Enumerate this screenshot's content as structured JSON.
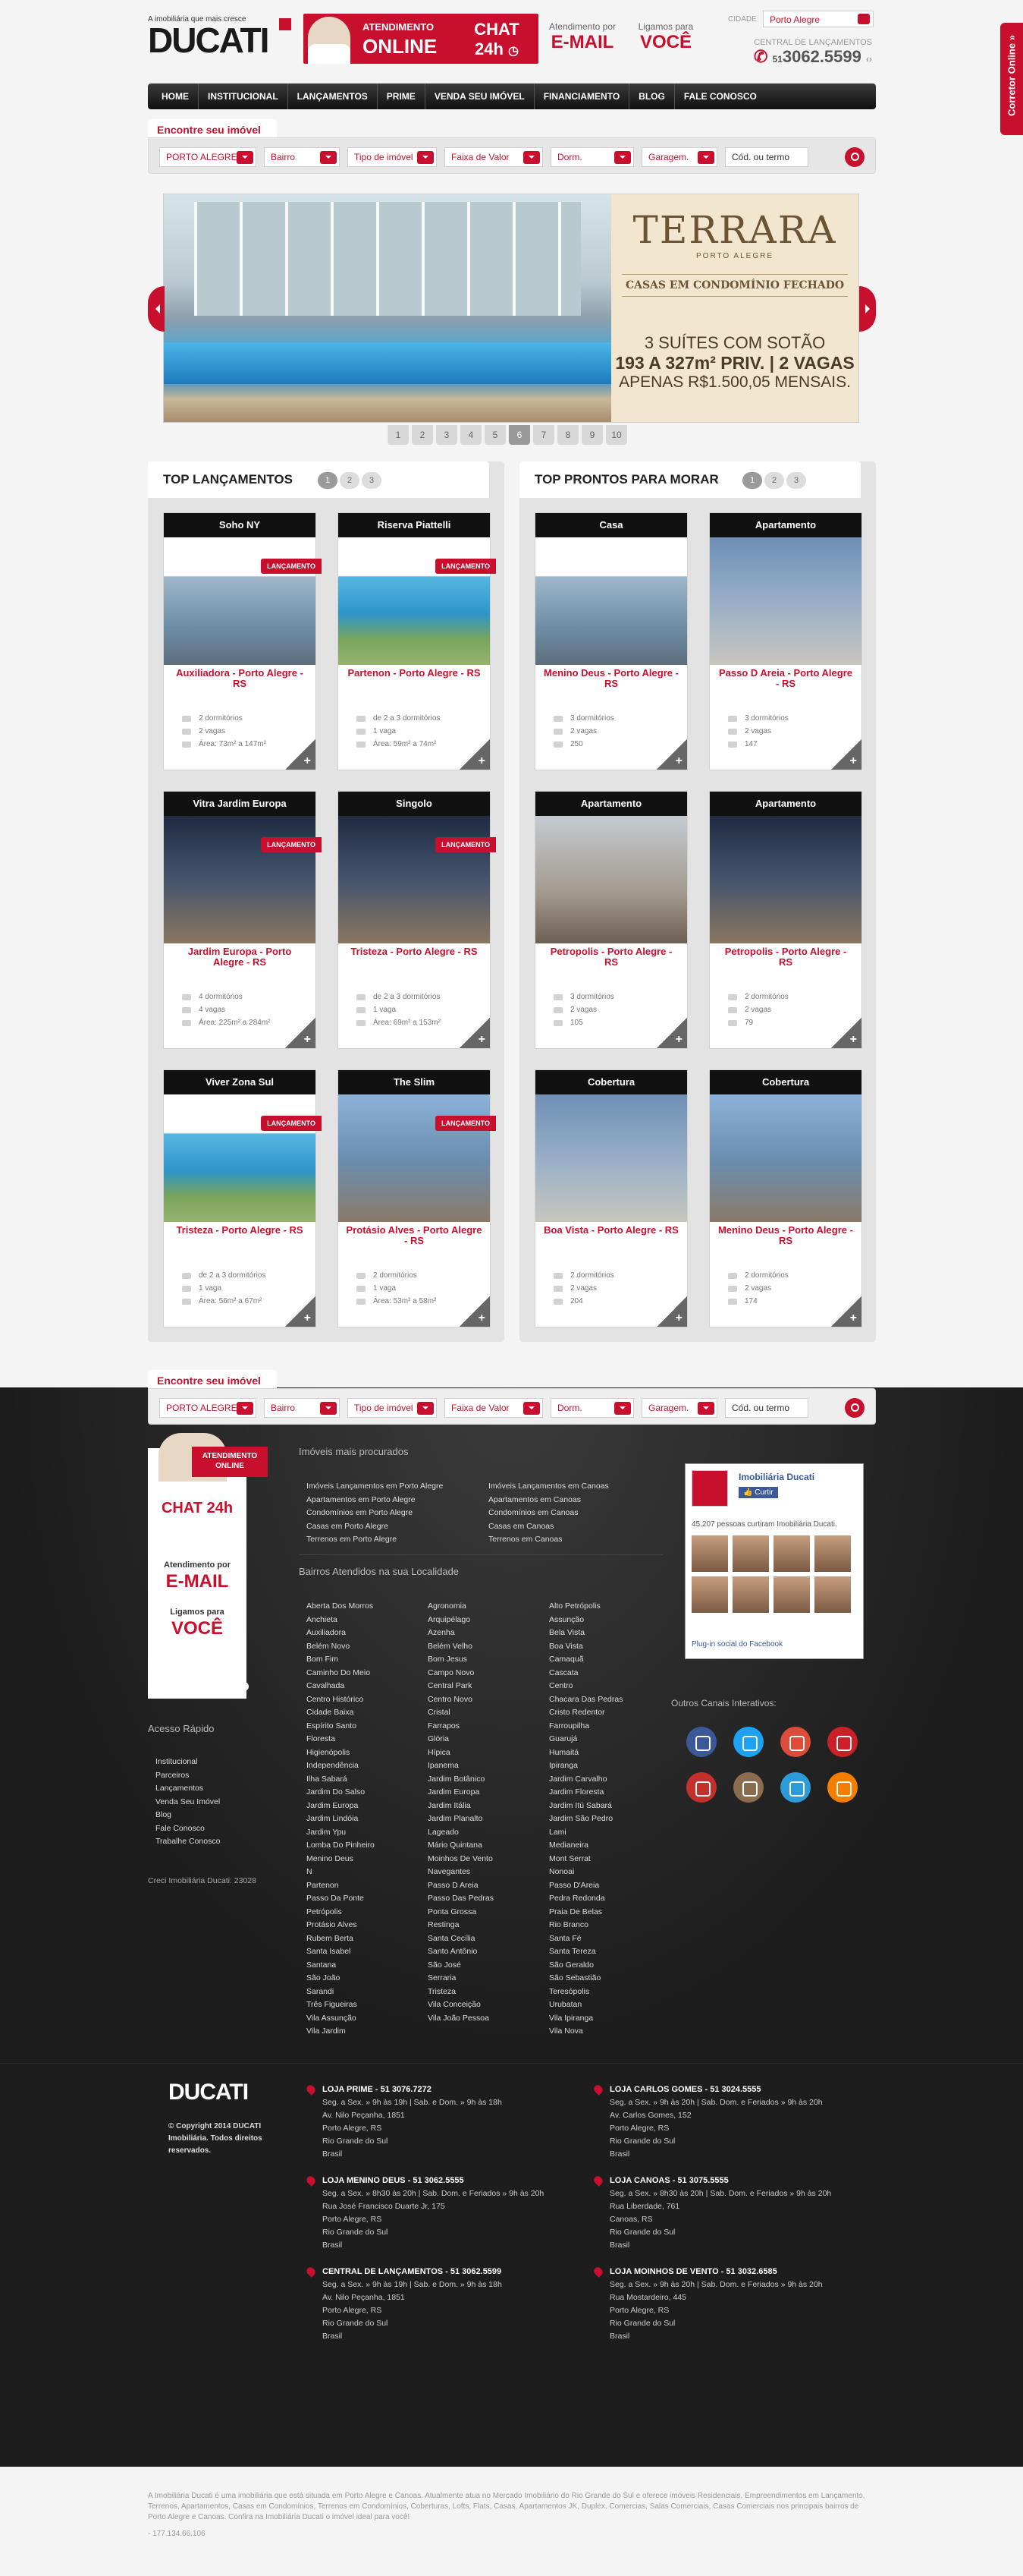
{
  "brand": {
    "tagline": "A imobiliária que mais cresce",
    "name": "DUCATI"
  },
  "banner": {
    "atendimento": "ATENDIMENTO",
    "online": "ONLINE",
    "chat": "CHAT",
    "hours": "24h"
  },
  "header_cols": [
    {
      "label": "Atendimento por",
      "value": "E-MAIL"
    },
    {
      "label": "Ligamos para",
      "value": "VOCÊ"
    }
  ],
  "city": {
    "label": "CIDADE",
    "value": "Porto Alegre"
  },
  "central": {
    "label": "CENTRAL DE LANÇAMENTOS",
    "ddd": "51",
    "phone": "3062.5599"
  },
  "nav": [
    "HOME",
    "INSTITUCIONAL",
    "LANÇAMENTOS",
    "PRIME",
    "VENDA SEU IMÓVEL",
    "FINANCIAMENTO",
    "BLOG",
    "FALE CONOSCO"
  ],
  "search": {
    "title": "Encontre seu imóvel",
    "fields": [
      "PORTO ALEGRE",
      "Bairro",
      "Tipo de imóvel",
      "Faixa de Valor",
      "Dorm.",
      "Garagem.",
      "Cód. ou termo"
    ]
  },
  "slide": {
    "brand": "TERRARA",
    "city": "PORTO ALEGRE",
    "subtitle": "CASAS EM CONDOMÍNIO FECHADO",
    "line1": "3 SUÍTES COM SOTÃO",
    "line2": "193 A 327m² PRIV. | 2 VAGAS",
    "line3": "APENAS R$1.500,05 MENSAIS."
  },
  "slide_pages": [
    "1",
    "2",
    "3",
    "4",
    "5",
    "6",
    "7",
    "8",
    "9",
    "10"
  ],
  "slide_active": "6",
  "lancamentos": {
    "title": "TOP LANÇAMENTOS",
    "pages": [
      "1",
      "2",
      "3"
    ],
    "badge": "LANÇAMENTO",
    "cards": [
      {
        "name": "Soho NY",
        "title": "Auxiliadora - Porto Alegre - RS",
        "d1": "2 dormitórios",
        "d2": "2 vagas",
        "d3": "Área: 73m² a 147m²"
      },
      {
        "name": "Riserva Piattelli",
        "title": "Partenon - Porto Alegre - RS",
        "d1": "de 2 a 3 dormitórios",
        "d2": "1 vaga",
        "d3": "Área: 59m² a 74m²"
      },
      {
        "name": "Vitra Jardim Europa",
        "title": "Jardim Europa - Porto Alegre - RS",
        "d1": "4 dormitórios",
        "d2": "4 vagas",
        "d3": "Área: 225m² a 284m²"
      },
      {
        "name": "Singolo",
        "title": "Tristeza - Porto Alegre - RS",
        "d1": "de 2 a 3 dormitórios",
        "d2": "1 vaga",
        "d3": "Área: 69m² a 153m²"
      },
      {
        "name": "Viver Zona Sul",
        "title": "Tristeza - Porto Alegre - RS",
        "d1": "de 2 a 3 dormitórios",
        "d2": "1 vaga",
        "d3": "Área: 56m² a 67m²"
      },
      {
        "name": "The Slim",
        "title": "Protásio Alves - Porto Alegre - RS",
        "d1": "2 dormitórios",
        "d2": "1 vaga",
        "d3": "Área: 53m² a 58m²"
      }
    ]
  },
  "prontos": {
    "title": "TOP PRONTOS PARA MORAR",
    "pages": [
      "1",
      "2",
      "3"
    ],
    "cards": [
      {
        "name": "Casa",
        "title": "Menino Deus - Porto Alegre - RS",
        "d1": "3 dormitórios",
        "d2": "2 vagas",
        "d3": "250"
      },
      {
        "name": "Apartamento",
        "title": "Passo D Areia - Porto Alegre - RS",
        "d1": "3 dormitórios",
        "d2": "2 vagas",
        "d3": "147"
      },
      {
        "name": "Apartamento",
        "title": "Petropolis - Porto Alegre - RS",
        "d1": "3 dormitórios",
        "d2": "2 vagas",
        "d3": "105"
      },
      {
        "name": "Apartamento",
        "title": "Petropolis - Porto Alegre - RS",
        "d1": "2 dormitórios",
        "d2": "2 vagas",
        "d3": "79"
      },
      {
        "name": "Cobertura",
        "title": "Boa Vista - Porto Alegre - RS",
        "d1": "2 dormitórios",
        "d2": "2 vagas",
        "d3": "204"
      },
      {
        "name": "Cobertura",
        "title": "Menino Deus - Porto Alegre - RS",
        "d1": "2 dormitórios",
        "d2": "2 vagas",
        "d3": "174"
      }
    ]
  },
  "footer": {
    "chat": {
      "badge": "ATENDIMENTO ONLINE",
      "chat": "CHAT 24h",
      "l1": "Atendimento por",
      "v1": "E-MAIL",
      "l2": "Ligamos para",
      "v2": "VOCÊ",
      "central": "CENTRAL DE LANÇAMENTOS",
      "ddd": "51",
      "phone": "3062.5599"
    },
    "acesso_title": "Acesso Rápido",
    "acesso": [
      "Institucional",
      "Parceiros",
      "Lançamentos",
      "Venda Seu Imóvel",
      "Blog",
      "Fale Conosco",
      "Trabalhe Conosco"
    ],
    "creci": "Creci Imobiliária Ducati: 23028",
    "procurados_title": "Imóveis mais procurados",
    "procurados_a": [
      "Imóveis Lançamentos em Porto Alegre",
      "Apartamentos em Porto Alegre",
      "Condomínios em Porto Alegre",
      "Casas em Porto Alegre",
      "Terrenos em Porto Alegre"
    ],
    "procurados_b": [
      "Imóveis Lançamentos em Canoas",
      "Apartamentos em Canoas",
      "Condomínios em Canoas",
      "Casas em Canoas",
      "Terrenos em Canoas"
    ],
    "bairros_title": "Bairros Atendidos na sua Localidade",
    "bairros_a": [
      "Aberta Dos Morros",
      "Anchieta",
      "Auxiliadora",
      "Belém Novo",
      "Bom Fim",
      "Caminho Do Meio",
      "Cavalhada",
      "Centro Histórico",
      "Cidade Baixa",
      "Espírito Santo",
      "Floresta",
      "Higienópolis",
      "Independência",
      "Ilha Sabará",
      "Jardim Do Salso",
      "Jardim Europa",
      "Jardim Lindóia",
      "Jardim Ypu",
      "Lomba Do Pinheiro",
      "Menino Deus",
      "N",
      "Partenon",
      "Passo Da Ponte",
      "Petrópolis",
      "Protásio Alves",
      "Rubem Berta",
      "Santa Isabel",
      "Santana",
      "São João",
      "Sarandi",
      "Três Figueiras",
      "Vila Assunção",
      "Vila Jardim"
    ],
    "bairros_b": [
      "Agronomia",
      "Arquipélago",
      "Azenha",
      "Belém Velho",
      "Bom Jesus",
      "Campo Novo",
      "Central Park",
      "Centro Novo",
      "Cristal",
      "Farrapos",
      "Glória",
      "Hípica",
      "Ipanema",
      "Jardim Botânico",
      "Jardim Europa",
      "Jardim Itália",
      "Jardim Planalto",
      "Lageado",
      "Mário Quintana",
      "Moinhos De Vento",
      "Navegantes",
      "Passo D Areia",
      "Passo Das Pedras",
      "Ponta Grossa",
      "Restinga",
      "Santa Cecília",
      "Santo Antônio",
      "São José",
      "Serraria",
      "Tristeza",
      "Vila Conceição",
      "Vila João Pessoa"
    ],
    "bairros_c": [
      "Alto Petrópolis",
      "Assunção",
      "Bela Vista",
      "Boa Vista",
      "Camaquã",
      "Cascata",
      "Centro",
      "Chacara Das Pedras",
      "Cristo Redentor",
      "Farroupilha",
      "Guarujá",
      "Humaitá",
      "Ipiranga",
      "Jardim Carvalho",
      "Jardim Floresta",
      "Jardim Itú Sabará",
      "Jardim São Pedro",
      "Lami",
      "Medianeira",
      "Mont Serrat",
      "Nonoai",
      "Passo D'Areia",
      "Pedra Redonda",
      "Praia De Belas",
      "Rio Branco",
      "Santa Fé",
      "Santa Tereza",
      "São Geraldo",
      "São Sebastião",
      "Teresópolis",
      "Urubatan",
      "Vila Ipiranga",
      "Vila Nova"
    ],
    "fb": {
      "name": "Imobiliária Ducati",
      "btn": "Curtir",
      "count": "45.207 pessoas curtiram Imobiliária Ducati.",
      "plugin": "Plug-in social do Facebook"
    },
    "canais_title": "Outros Canais Interativos:",
    "social": [
      {
        "name": "facebook-icon",
        "color": "#3b5998"
      },
      {
        "name": "twitter-icon",
        "color": "#1da1f2"
      },
      {
        "name": "google-icon",
        "color": "#dd4b39"
      },
      {
        "name": "pinterest-icon",
        "color": "#cb2027"
      },
      {
        "name": "youtube-icon",
        "color": "#c4302b"
      },
      {
        "name": "instagram-icon",
        "color": "#8a6d4f"
      },
      {
        "name": "foursquare-icon",
        "color": "#2d9bd8"
      },
      {
        "name": "blogger-icon",
        "color": "#f57d00"
      }
    ],
    "copyright": "© Copyright 2014 DUCATI Imobiliária. Todos direitos reservados.",
    "lojas": [
      {
        "h": "LOJA PRIME - 51 3076.7272",
        "l": [
          "Seg. a Sex. » 9h às 19h | Sab. e Dom. » 9h às 18h",
          "Av. Nilo Peçanha, 1851",
          "Porto Alegre, RS",
          "Rio Grande do Sul",
          "Brasil"
        ]
      },
      {
        "h": "LOJA CARLOS GOMES - 51 3024.5555",
        "l": [
          "Seg. a Sex. » 9h às 20h | Sab. Dom. e Feriados » 9h às 20h",
          "Av. Carlos Gomes, 152",
          "Porto Alegre, RS",
          "Rio Grande do Sul",
          "Brasil"
        ]
      },
      {
        "h": "LOJA MENINO DEUS - 51 3062.5555",
        "l": [
          "Seg. a Sex. » 8h30 às 20h | Sab. Dom. e Feriados » 9h às 20h",
          "Rua José Francisco Duarte Jr, 175",
          "Porto Alegre, RS",
          "Rio Grande do Sul",
          "Brasil"
        ]
      },
      {
        "h": "LOJA CANOAS - 51 3075.5555",
        "l": [
          "Seg. a Sex. » 8h30 às 20h | Sab. Dom. e Feriados » 9h às 20h",
          "Rua Liberdade, 761",
          "Canoas, RS",
          "Rio Grande do Sul",
          "Brasil"
        ]
      },
      {
        "h": "CENTRAL DE LANÇAMENTOS - 51 3062.5599",
        "l": [
          "Seg. a Sex. » 9h às 19h | Sab. e Dom. » 9h às 18h",
          "Av. Nilo Peçanha, 1851",
          "Porto Alegre, RS",
          "Rio Grande do Sul",
          "Brasil"
        ]
      },
      {
        "h": "LOJA MOINHOS DE VENTO - 51 3032.6585",
        "l": [
          "Seg. a Sex. » 9h às 20h | Sab. Dom. e Feriados » 9h às 20h",
          "Rua Mostardeiro, 445",
          "Porto Alegre, RS",
          "Rio Grande do Sul",
          "Brasil"
        ]
      }
    ],
    "legal": "A Imobiliária Ducati é uma imobiliária que está situada em Porto Alegre e Canoas. Atualmente atua no Mercado Imobiliário do Rio Grande do Sul e oferece imóveis Residenciais, Empreendimentos em Lançamento, Terrenos, Apartamentos, Casas em Condomínios, Terrenos em Condomínios, Coberturas, Lofts, Flats, Casas, Apartamentos JK, Duplex, Comercias, Salas Comerciais, Casas Comerciais nos principais bairros de Porto Alegre e Canoas. Confira na Imobiliária Ducati o imóvel ideal para você!",
    "ip": "- 177.134.66.106"
  },
  "side_tab": "Corretor Online »"
}
